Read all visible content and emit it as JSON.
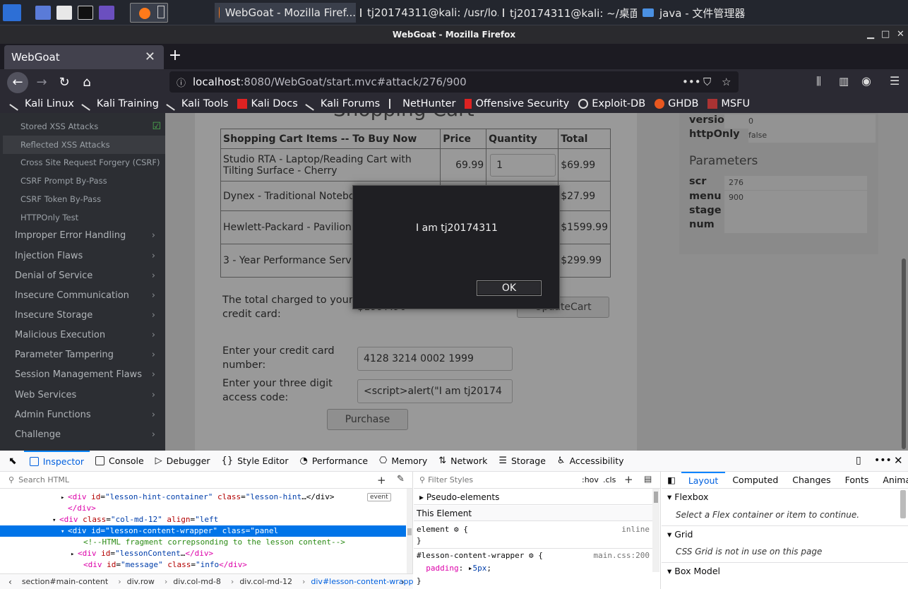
{
  "taskbar": {
    "tasks": [
      {
        "label": "WebGoat - Mozilla Firef..."
      },
      {
        "label": "tj20174311@kali: /usr/lo..."
      },
      {
        "label": "tj20174311@kali: ~/桌面"
      },
      {
        "label": "java - 文件管理器"
      }
    ]
  },
  "window": {
    "title": "WebGoat - Mozilla Firefox"
  },
  "browser": {
    "tab_title": "WebGoat",
    "url_host": "localhost",
    "url_path": ":8080/WebGoat/start.mvc#attack/276/900",
    "bookmarks": [
      "Kali Linux",
      "Kali Training",
      "Kali Tools",
      "Kali Docs",
      "Kali Forums",
      "NetHunter",
      "Offensive Security",
      "Exploit-DB",
      "GHDB",
      "MSFU"
    ]
  },
  "sidebar": {
    "sub_items": [
      "Stored XSS Attacks",
      "Reflected XSS Attacks",
      "Cross Site Request Forgery (CSRF)",
      "CSRF Prompt By-Pass",
      "CSRF Token By-Pass",
      "HTTPOnly Test"
    ],
    "categories": [
      "Improper Error Handling",
      "Injection Flaws",
      "Denial of Service",
      "Insecure Communication",
      "Insecure Storage",
      "Malicious Execution",
      "Parameter Tampering",
      "Session Management Flaws",
      "Web Services",
      "Admin Functions",
      "Challenge"
    ]
  },
  "lesson": {
    "heading_partial": "Shopping Cart",
    "table": {
      "headers": [
        "Shopping Cart Items -- To Buy Now",
        "Price",
        "Quantity",
        "Total"
      ],
      "rows": [
        {
          "item": "Studio RTA - Laptop/Reading Cart with Tilting Surface - Cherry",
          "price": "69.99",
          "qty": "1",
          "total": "$69.99"
        },
        {
          "item": "Dynex - Traditional Notebo",
          "price": "",
          "qty": "",
          "total": "$27.99"
        },
        {
          "item": "Hewlett-Packard - Pavilion Intel Centrino",
          "price": "",
          "qty": "",
          "total": "$1599.99"
        },
        {
          "item": "3 - Year Performance Serv and Over",
          "price": "",
          "qty": "",
          "total": "$299.99"
        }
      ]
    },
    "total_label": "The total charged to your credit card:",
    "total_value": "$1997.96",
    "update_button": "UpdateCart",
    "card_label": "Enter your credit card number:",
    "card_value": "4128 3214 0002 1999",
    "code_label": "Enter your three digit access code:",
    "code_value": "<script>alert(\"I am tj20174",
    "purchase_button": "Purchase"
  },
  "cookie_panel": {
    "rows": [
      {
        "key": "version",
        "value": "0"
      },
      {
        "key": "httpOnly",
        "value": "false"
      }
    ],
    "params_title": "Parameters",
    "params": [
      {
        "key": "scr",
        "value": "276"
      },
      {
        "key": "menu",
        "value": "900"
      },
      {
        "key": "stage",
        "value": ""
      },
      {
        "key": "num",
        "value": ""
      }
    ]
  },
  "alert": {
    "message": "I am tj20174311",
    "ok": "OK"
  },
  "devtools": {
    "tabs": [
      "Inspector",
      "Console",
      "Debugger",
      "Style Editor",
      "Performance",
      "Memory",
      "Network",
      "Storage",
      "Accessibility"
    ],
    "search_placeholder": "Search HTML",
    "filter_placeholder": "Filter Styles",
    "hov": ":hov",
    "cls": ".cls",
    "layout_tabs": [
      "Layout",
      "Computed",
      "Changes",
      "Fonts",
      "Animat"
    ],
    "html_lines": [
      {
        "indent": 96,
        "arrow": "▸",
        "html": "<span class='tag'>&lt;div</span> <span class='an'>id</span>=<span class='av'>\"lesson-hint-container\"</span> <span class='an'>class</span>=<span class='av'>\"lesson-hint</span>…&lt;/div&gt;"
      },
      {
        "indent": 96,
        "arrow": "",
        "html": "<span class='tag'>&lt;/div&gt;</span>"
      },
      {
        "indent": 84,
        "arrow": "▾",
        "html": "<span class='tag'>&lt;div</span> <span class='an'>class</span>=<span class='av'>\"col-md-12\"</span> <span class='an'>align</span>=<span class='av'>\"left</span>"
      },
      {
        "indent": 96,
        "arrow": "▾",
        "html": "<span class='tag'>&lt;div</span> <span class='an'>id</span>=<span class='av'>\"lesson-content-wrapper\"</span> <span class='an'>class</span>=<span class='av'>\"panel</span>"
      },
      {
        "indent": 118,
        "arrow": "",
        "html": "<span class='cm'>&lt;!--HTML fragment correpsonding to the lesson content--&gt;</span>"
      },
      {
        "indent": 110,
        "arrow": "▸",
        "html": "<span class='tag'>&lt;div</span> <span class='an'>id</span>=<span class='av'>\"lessonContent</span>…<span class='tag'>&lt;/div&gt;</span>"
      },
      {
        "indent": 118,
        "arrow": "",
        "html": "<span class='tag'>&lt;div</span> <span class='an'>id</span>=<span class='av'>\"message\"</span> <span class='an'>class</span>=<span class='av'>\"info</span><span class='tag'>&lt;/div&gt;</span>"
      }
    ],
    "event_badge": "event",
    "rules": {
      "pseudo": "Pseudo-elements",
      "this_element": "This Element",
      "element_sel": "element",
      "inline": "inline",
      "rule_sel": "#lesson-content-wrapper",
      "rule_src": "main.css:200",
      "prop": "padding",
      "val": "5px"
    },
    "layout": {
      "flexbox": "Flexbox",
      "flex_note": "Select a Flex container or item to continue.",
      "grid": "Grid",
      "grid_note": "CSS Grid is not in use on this page",
      "box_model": "Box Model"
    },
    "breadcrumb": [
      {
        "tag": "section",
        "rest": "#main-content"
      },
      {
        "tag": "div",
        "rest": ".row"
      },
      {
        "tag": "div",
        "rest": ".col-md-8"
      },
      {
        "tag": "div",
        "rest": ".col-md-12"
      },
      {
        "tag": "div",
        "rest": "#lesson-content-wrapper.panel"
      }
    ]
  }
}
